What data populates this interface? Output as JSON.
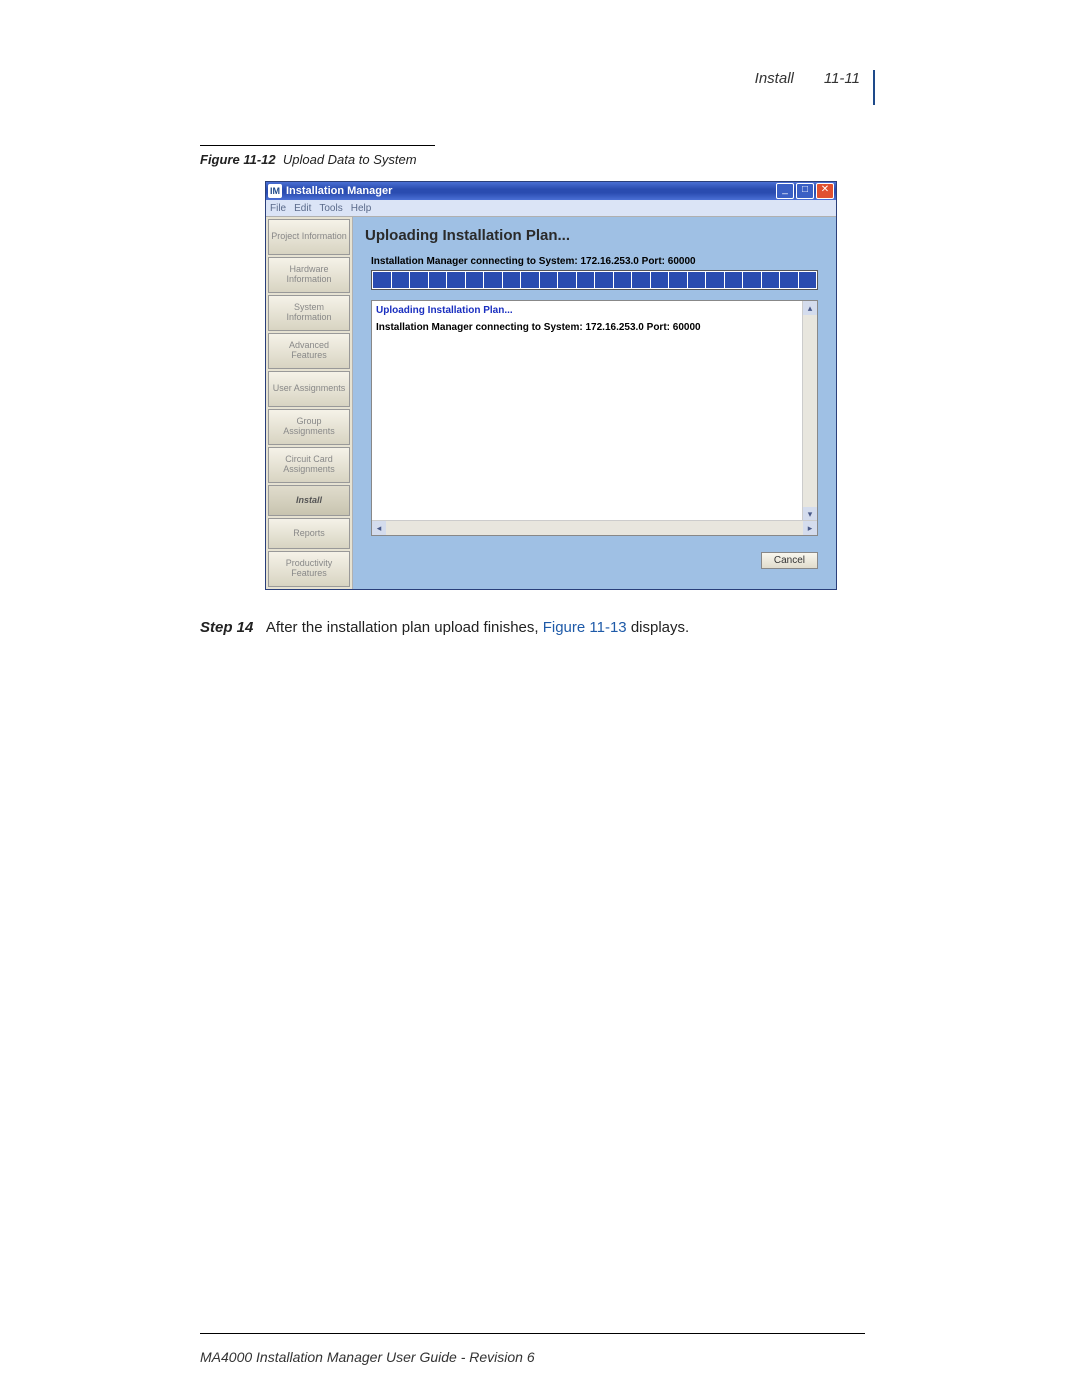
{
  "header": {
    "section": "Install",
    "page_num": "11-11"
  },
  "figure": {
    "label": "Figure 11-12",
    "title": "Upload Data to System"
  },
  "window": {
    "title": "Installation Manager",
    "menus": [
      "File",
      "Edit",
      "Tools",
      "Help"
    ],
    "sidebar": [
      "Project Information",
      "Hardware Information",
      "System Information",
      "Advanced Features",
      "User Assignments",
      "Group Assignments",
      "Circuit Card Assignments",
      "Install",
      "Reports",
      "Productivity Features"
    ],
    "sidebar_active": "Install",
    "panel_title": "Uploading Installation Plan...",
    "progress_label": "Installation Manager connecting to System: 172.16.253.0 Port: 60000",
    "progress_blocks": 24,
    "log_title": "Uploading Installation Plan...",
    "log_line": "Installation Manager connecting to System: 172.16.253.0 Port: 60000",
    "cancel": "Cancel"
  },
  "step": {
    "label": "Step 14",
    "text_before": "After the installation plan upload finishes, ",
    "ref": "Figure 11-13",
    "text_after": " displays."
  },
  "footer": "MA4000 Installation Manager User Guide - Revision 6"
}
